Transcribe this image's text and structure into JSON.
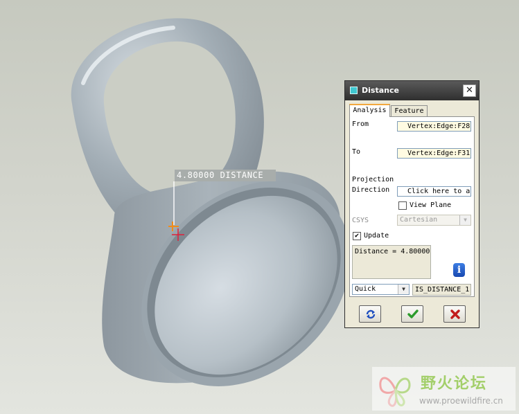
{
  "viewport": {
    "dimension_label": "4.80000  DISTANCE"
  },
  "dialog": {
    "title": "Distance",
    "close_glyph": "✕",
    "tabs": [
      {
        "label": "Analysis",
        "active": true
      },
      {
        "label": "Feature",
        "active": false
      }
    ],
    "from_label": "From",
    "from_value": "Vertex:Edge:F28",
    "to_label": "To",
    "to_value": "Vertex:Edge:F31",
    "projection_label": "Projection",
    "direction_label": "Direction",
    "direction_value": "Click here to a",
    "view_plane_label": "View Plane",
    "view_plane_checked": false,
    "csys_label": "CSYS",
    "csys_value": "Cartesian",
    "update_label": "Update",
    "update_checked": true,
    "result_text": "Distance = 4.80000",
    "mode_value": "Quick",
    "name_value": "IS_DISTANCE_1",
    "icons": {
      "info": "info-icon",
      "repeat": "repeat-icon",
      "ok": "checkmark-icon",
      "cancel": "x-icon"
    }
  },
  "watermark": {
    "title": "野火论坛",
    "url": "www.proewildfire.cn"
  },
  "colors": {
    "titlebar": "#3a3a3a",
    "dialog_bg": "#ece9d8",
    "ok_green": "#2c9b2c",
    "cancel_red": "#c21b1b",
    "repeat_blue": "#1f4fbf",
    "model_gray": "#9aa5ad"
  }
}
